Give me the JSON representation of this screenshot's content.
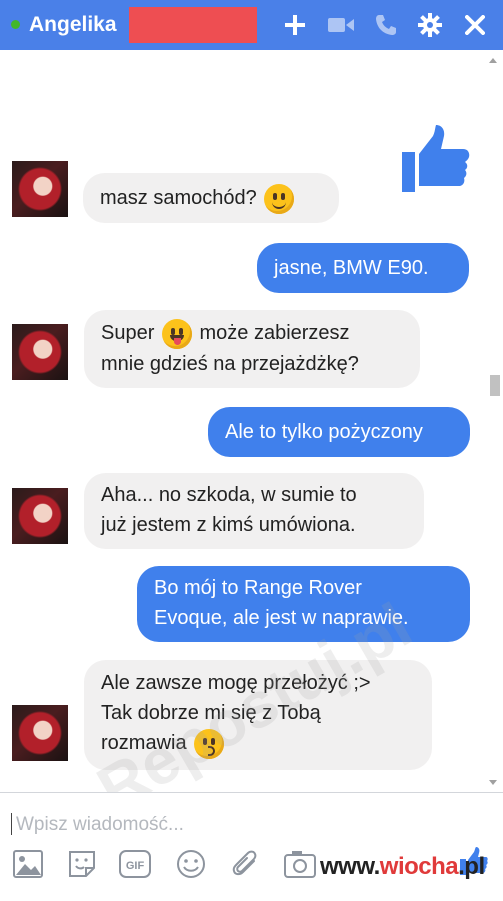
{
  "header": {
    "contact_name": "Angelika",
    "status": "online",
    "icons": [
      "add-person-icon",
      "video-call-icon",
      "phone-icon",
      "gear-icon",
      "close-icon"
    ]
  },
  "messages": [
    {
      "from": "me",
      "type": "sticker",
      "icon": "thumbs-up-icon"
    },
    {
      "from": "them",
      "text": "masz samochód?",
      "emoji": "smile"
    },
    {
      "from": "me",
      "text": "jasne, BMW E90."
    },
    {
      "from": "them",
      "line1_a": "Super",
      "line1_b": "może zabierzesz",
      "line2": "mnie gdzieś na przejażdżkę?",
      "emoji": "tongue"
    },
    {
      "from": "me",
      "text": "Ale to tylko pożyczony"
    },
    {
      "from": "them",
      "line1": "Aha... no szkoda, w sumie to",
      "line2": "już jestem z kimś umówiona."
    },
    {
      "from": "me",
      "line1": "Bo mój to Range Rover",
      "line2": "Evoque, ale jest w naprawie."
    },
    {
      "from": "them",
      "line1": "Ale zawsze mogę przełożyć ;>",
      "line2": "Tak dobrze mi się z Tobą",
      "line3": "rozmawia",
      "emoji": "kiss"
    }
  ],
  "watermark": "Repostuj.pl",
  "composer": {
    "placeholder": "Wpisz wiadomość...",
    "value": "",
    "toolbar_icons": [
      "photo-icon",
      "sticker-icon",
      "gif-icon",
      "emoji-icon",
      "attach-icon",
      "camera-icon",
      "like-icon"
    ]
  },
  "footer": {
    "logo_prefix": "www.",
    "logo_main": "wiocha",
    "logo_suffix": ".pl"
  },
  "colors": {
    "header_bg": "#4a80e8",
    "outgoing_bubble": "#4080ec",
    "incoming_bubble": "#f1f0f0",
    "status_online": "#42b72a",
    "redaction": "#ee4e52"
  }
}
